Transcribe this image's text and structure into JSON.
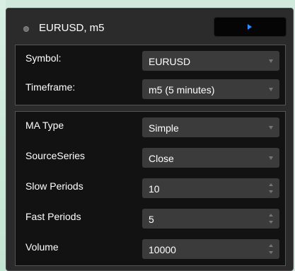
{
  "header": {
    "title": "EURUSD, m5",
    "status_icon": "status-dot-icon",
    "play_icon": "play-icon"
  },
  "instrument": {
    "symbol": {
      "label": "Symbol:",
      "value": "EURUSD",
      "control": "dropdown"
    },
    "timeframe": {
      "label": "Timeframe:",
      "value": "m5 (5 minutes)",
      "control": "dropdown"
    }
  },
  "parameters": {
    "ma_type": {
      "label": "MA Type",
      "value": "Simple",
      "control": "dropdown"
    },
    "source_series": {
      "label": "SourceSeries",
      "value": "Close",
      "control": "dropdown"
    },
    "slow_periods": {
      "label": "Slow Periods",
      "value": "10",
      "control": "spinner"
    },
    "fast_periods": {
      "label": "Fast Periods",
      "value": "5",
      "control": "spinner"
    },
    "volume": {
      "label": "Volume",
      "value": "10000",
      "control": "spinner"
    }
  },
  "colors": {
    "panel_bg": "#2b2b2b",
    "section_bg": "#121212",
    "field_bg": "#3b3b3b",
    "play_accent": "#2f8cff",
    "page_bg": "#cfe9dc"
  }
}
